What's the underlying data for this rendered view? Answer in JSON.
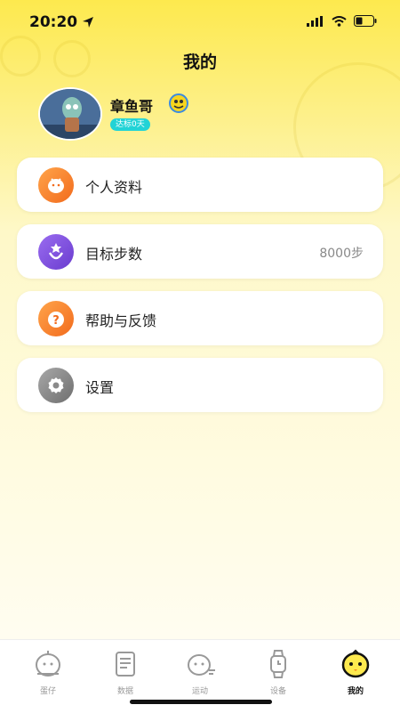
{
  "status_bar": {
    "time": "20:20"
  },
  "header": {
    "title": "我的"
  },
  "profile": {
    "name": "章鱼哥",
    "goal_badge": "达标0天"
  },
  "menu": [
    {
      "label": "个人资料",
      "value": "",
      "icon": "profile-icon",
      "color": "#f5892b"
    },
    {
      "label": "目标步数",
      "value": "8000步",
      "icon": "goal-icon",
      "color": "#7c4ddb"
    },
    {
      "label": "帮助与反馈",
      "value": "",
      "icon": "help-icon",
      "color": "#f5892b"
    },
    {
      "label": "设置",
      "value": "",
      "icon": "gear-icon",
      "color": "#8a8a8a"
    }
  ],
  "tabs": [
    {
      "label": "蛋仔",
      "icon": "egg-icon",
      "active": false
    },
    {
      "label": "数据",
      "icon": "data-icon",
      "active": false
    },
    {
      "label": "运动",
      "icon": "sport-icon",
      "active": false
    },
    {
      "label": "设备",
      "icon": "watch-icon",
      "active": false
    },
    {
      "label": "我的",
      "icon": "chick-icon",
      "active": true
    }
  ],
  "colors": {
    "accent": "#fde94e",
    "active_tab": "#111111",
    "badge": "#22d3d6"
  }
}
